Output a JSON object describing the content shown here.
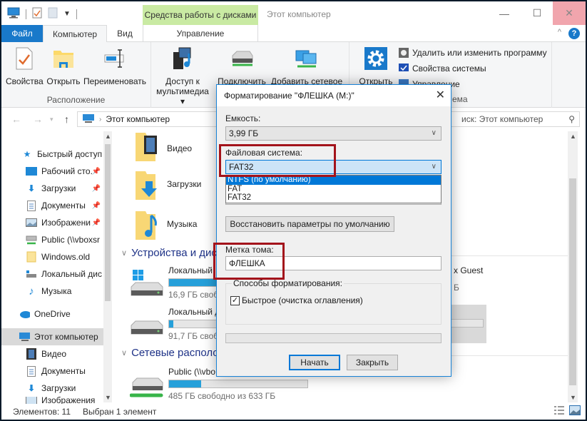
{
  "window": {
    "title": "Этот компьютер",
    "context_tab_header": "Средства работы с дисками",
    "controls": {
      "minimize": "—",
      "maximize": "☐",
      "close": "✕"
    }
  },
  "tabs": [
    {
      "label": "Файл"
    },
    {
      "label": "Компьютер"
    },
    {
      "label": "Вид"
    },
    {
      "label": "Управление"
    }
  ],
  "ribbon": {
    "location_group": {
      "label": "Расположение",
      "buttons": [
        {
          "label": "Свойства",
          "icon": "properties-icon"
        },
        {
          "label": "Открыть",
          "icon": "open-folder-icon"
        },
        {
          "label": "Переименовать",
          "icon": "rename-icon"
        }
      ]
    },
    "network_group": {
      "buttons": [
        {
          "label_line1": "Доступ к",
          "label_line2": "мультимедиа ▾",
          "icon": "media-access-icon"
        },
        {
          "label": "Подключить",
          "icon": "map-drive-icon"
        },
        {
          "label": "Добавить сетевое",
          "icon": "network-location-icon"
        }
      ]
    },
    "system_group": {
      "open_label": "Открыть",
      "items": [
        {
          "label": "Удалить или изменить программу"
        },
        {
          "label": "Свойства системы"
        },
        {
          "label": "Управление"
        }
      ],
      "group_label_partial": "ема"
    }
  },
  "navigation": {
    "address": "Этот компьютер",
    "search_placeholder": "Поиск: Этот компьютер",
    "search_visible": "иск: Этот компьютер"
  },
  "sidebar": {
    "items": [
      {
        "label": "Быстрый доступ",
        "icon": "star-icon"
      },
      {
        "label": "Рабочий сто.",
        "icon": "desktop-icon",
        "pinned": true
      },
      {
        "label": "Загрузки",
        "icon": "download-icon",
        "pinned": true
      },
      {
        "label": "Документы",
        "icon": "document-icon",
        "pinned": true
      },
      {
        "label": "Изображени",
        "icon": "picture-icon",
        "pinned": true
      },
      {
        "label": "Public (\\\\vboxsr",
        "icon": "network-drive-icon"
      },
      {
        "label": "Windows.old",
        "icon": "folder-icon"
      },
      {
        "label": "Локальный дис",
        "icon": "local-disk-icon"
      },
      {
        "label": "Музыка",
        "icon": "music-icon"
      },
      {
        "label": "OneDrive",
        "icon": "cloud-icon"
      },
      {
        "label": "Этот компьютер",
        "icon": "computer-icon",
        "selected": true
      },
      {
        "label": "Видео",
        "icon": "video-icon"
      },
      {
        "label": "Документы",
        "icon": "document-icon"
      },
      {
        "label": "Загрузки",
        "icon": "download-icon"
      },
      {
        "label": "Изображения",
        "icon": "picture-icon"
      }
    ]
  },
  "content": {
    "folders": [
      {
        "name": "Видео"
      },
      {
        "name": "Загрузки"
      },
      {
        "name": "Музыка"
      }
    ],
    "sections": {
      "devices": "Устройства и дис",
      "network": "Сетевые располо"
    },
    "drives": [
      {
        "name": "Локальный",
        "sub": "16,9 ГБ свобо",
        "used_fraction": 0.75
      },
      {
        "name": "Локальный д",
        "sub": "91,7 ГБ свобо",
        "used_fraction": 0.03
      }
    ],
    "network_drives": [
      {
        "name": "Public (\\\\vbo",
        "sub": "485 ГБ свободно из 633 ГБ",
        "used_fraction": 0.23
      }
    ],
    "right_partial": {
      "guest": "x Guest",
      "partial_b": "Б"
    }
  },
  "statusbar": {
    "items_count": "Элементов: 11",
    "selected": "Выбран 1 элемент"
  },
  "dialog": {
    "title": "Форматирование \"ФЛЕШКА (M:)\"",
    "capacity_label": "Емкость:",
    "capacity_value": "3,99 ГБ",
    "filesystem_label": "Файловая система:",
    "filesystem_value": "FAT32",
    "filesystem_options": [
      "NTFS (по умолчанию)",
      "FAT",
      "FAT32"
    ],
    "filesystem_highlighted": "NTFS (по умолчанию)",
    "restore_defaults": "Восстановить параметры по умолчанию",
    "volume_label": "Метка тома:",
    "volume_value": "ФЛЕШКА",
    "format_options_label": "Способы форматирования:",
    "quick_format_label": "Быстрое (очистка оглавления)",
    "quick_format_checked": true,
    "progress": 0,
    "start_button": "Начать",
    "close_button": "Закрыть"
  },
  "colors": {
    "accent": "#1979ca",
    "context_tab": "#c9eaa3",
    "highlight_box": "#a3131b",
    "selection": "#0078d7",
    "drive_bar": "#26a0da"
  }
}
